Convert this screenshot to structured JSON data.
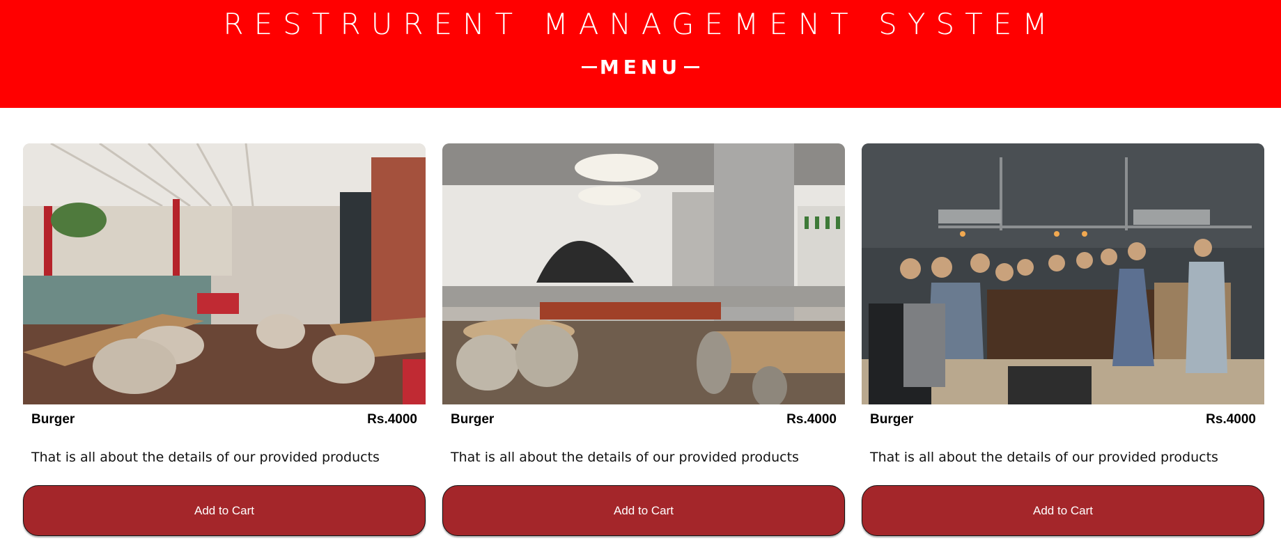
{
  "header": {
    "title": "RESTRURENT MANAGEMENT SYSTEM",
    "subtitle": "MENU",
    "background_color": "#ff0000"
  },
  "menu_items": [
    {
      "name": "Burger",
      "price": "Rs.4000",
      "description": "That is all about the details of our provided products",
      "button_label": "Add to Cart",
      "image": "restaurant-interior-photo"
    },
    {
      "name": "Burger",
      "price": "Rs.4000",
      "description": "That is all about the details of our provided products",
      "button_label": "Add to Cart",
      "image": "restaurant-interior-photo"
    },
    {
      "name": "Burger",
      "price": "Rs.4000",
      "description": "That is all about the details of our provided products",
      "button_label": "Add to Cart",
      "image": "restaurant-bar-photo"
    }
  ],
  "colors": {
    "button": "#a4262a",
    "header": "#ff0000"
  }
}
